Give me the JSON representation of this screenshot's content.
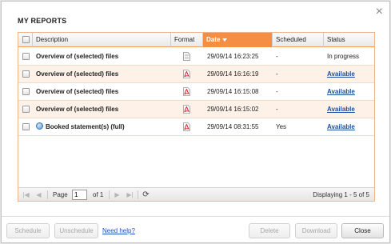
{
  "dialog": {
    "title": "MY REPORTS",
    "close_glyph": "×"
  },
  "grid": {
    "columns": {
      "description": "Description",
      "format": "Format",
      "date": "Date",
      "scheduled": "Scheduled",
      "status": "Status"
    },
    "sorted_column": "date",
    "sort_direction": "desc",
    "rows": [
      {
        "description": "Overview of (selected) files",
        "format": "document-icon",
        "date": "29/09/14 16:23:25",
        "scheduled": "-",
        "status": "In progress",
        "status_link": false,
        "scheduled_icon": false
      },
      {
        "description": "Overview of (selected) files",
        "format": "pdf-icon",
        "date": "29/09/14 16:16:19",
        "scheduled": "-",
        "status": "Available",
        "status_link": true,
        "scheduled_icon": false
      },
      {
        "description": "Overview of (selected) files",
        "format": "pdf-icon",
        "date": "29/09/14 16:15:08",
        "scheduled": "-",
        "status": "Available",
        "status_link": true,
        "scheduled_icon": false
      },
      {
        "description": "Overview of (selected) files",
        "format": "pdf-icon",
        "date": "29/09/14 16:15:02",
        "scheduled": "-",
        "status": "Available",
        "status_link": true,
        "scheduled_icon": false
      },
      {
        "description": "Booked statement(s) (full)",
        "format": "pdf-icon",
        "date": "29/09/14 08:31:55",
        "scheduled": "Yes",
        "status": "Available",
        "status_link": true,
        "scheduled_icon": true
      }
    ]
  },
  "pager": {
    "page_label": "Page",
    "page_value": "1",
    "of_label": "of 1",
    "displaying": "Displaying 1 - 5 of 5",
    "first_glyph": "|◀",
    "prev_glyph": "◀",
    "next_glyph": "▶",
    "last_glyph": "▶|",
    "refresh_glyph": "⟳"
  },
  "footer": {
    "schedule": "Schedule",
    "unschedule": "Unschedule",
    "help": "Need help?",
    "delete": "Delete",
    "download": "Download",
    "close": "Close"
  },
  "colors": {
    "accent": "#f58d42",
    "row_alt": "#fdf1e8",
    "link": "#1f4f9c",
    "pdf_red": "#d2232a"
  }
}
